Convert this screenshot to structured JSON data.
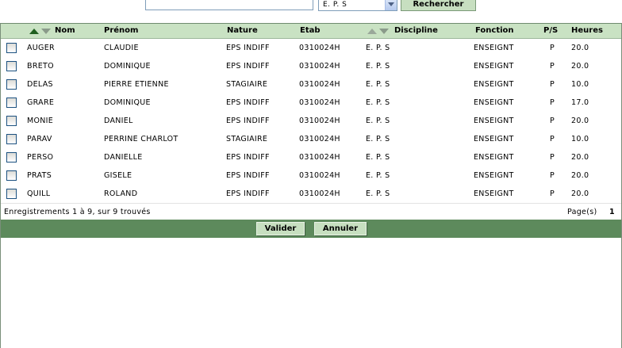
{
  "search": {
    "input_value": "",
    "select_value": "E. P. S",
    "button_label": "Rechercher"
  },
  "table": {
    "headers": {
      "nom": "Nom",
      "prenom": "Prénom",
      "nature": "Nature",
      "etab": "Etab",
      "discipline": "Discipline",
      "fonction": "Fonction",
      "ps": "P/S",
      "heures": "Heures"
    },
    "rows": [
      {
        "nom": "AUGER",
        "prenom": "CLAUDIE",
        "nature": "EPS INDIFF",
        "etab": "0310024H",
        "discipline": "E. P. S",
        "fonction": "ENSEIGNT",
        "ps": "P",
        "heures": "20.0"
      },
      {
        "nom": "BRETO",
        "prenom": "DOMINIQUE",
        "nature": "EPS INDIFF",
        "etab": "0310024H",
        "discipline": "E. P. S",
        "fonction": "ENSEIGNT",
        "ps": "P",
        "heures": "20.0"
      },
      {
        "nom": "DELAS",
        "prenom": "PIERRE ETIENNE",
        "nature": "STAGIAIRE",
        "etab": "0310024H",
        "discipline": "E. P. S",
        "fonction": "ENSEIGNT",
        "ps": "P",
        "heures": "10.0"
      },
      {
        "nom": "GRARE",
        "prenom": "DOMINIQUE",
        "nature": "EPS INDIFF",
        "etab": "0310024H",
        "discipline": "E. P. S",
        "fonction": "ENSEIGNT",
        "ps": "P",
        "heures": "17.0"
      },
      {
        "nom": "MONIE",
        "prenom": "DANIEL",
        "nature": "EPS INDIFF",
        "etab": "0310024H",
        "discipline": "E. P. S",
        "fonction": "ENSEIGNT",
        "ps": "P",
        "heures": "20.0"
      },
      {
        "nom": "PARAV",
        "prenom": "PERRINE CHARLOT",
        "nature": "STAGIAIRE",
        "etab": "0310024H",
        "discipline": "E. P. S",
        "fonction": "ENSEIGNT",
        "ps": "P",
        "heures": "10.0"
      },
      {
        "nom": "PERSO",
        "prenom": "DANIELLE",
        "nature": "EPS INDIFF",
        "etab": "0310024H",
        "discipline": "E. P. S",
        "fonction": "ENSEIGNT",
        "ps": "P",
        "heures": "20.0"
      },
      {
        "nom": "PRATS",
        "prenom": "GISELE",
        "nature": "EPS INDIFF",
        "etab": "0310024H",
        "discipline": "E. P. S",
        "fonction": "ENSEIGNT",
        "ps": "P",
        "heures": "20.0"
      },
      {
        "nom": "QUILL",
        "prenom": "ROLAND",
        "nature": "EPS INDIFF",
        "etab": "0310024H",
        "discipline": "E. P. S",
        "fonction": "ENSEIGNT",
        "ps": "P",
        "heures": "20.0"
      }
    ]
  },
  "footer": {
    "records_text": "Enregistrements 1 à 9, sur 9 trouvés",
    "pages_label": "Page(s)",
    "pages_value": "1"
  },
  "actions": {
    "validate_label": "Valider",
    "cancel_label": "Annuler"
  },
  "colors": {
    "header_bg": "#c9e2c3",
    "action_bar_bg": "#5d8a5c",
    "button_bg": "#c7dfc0"
  }
}
